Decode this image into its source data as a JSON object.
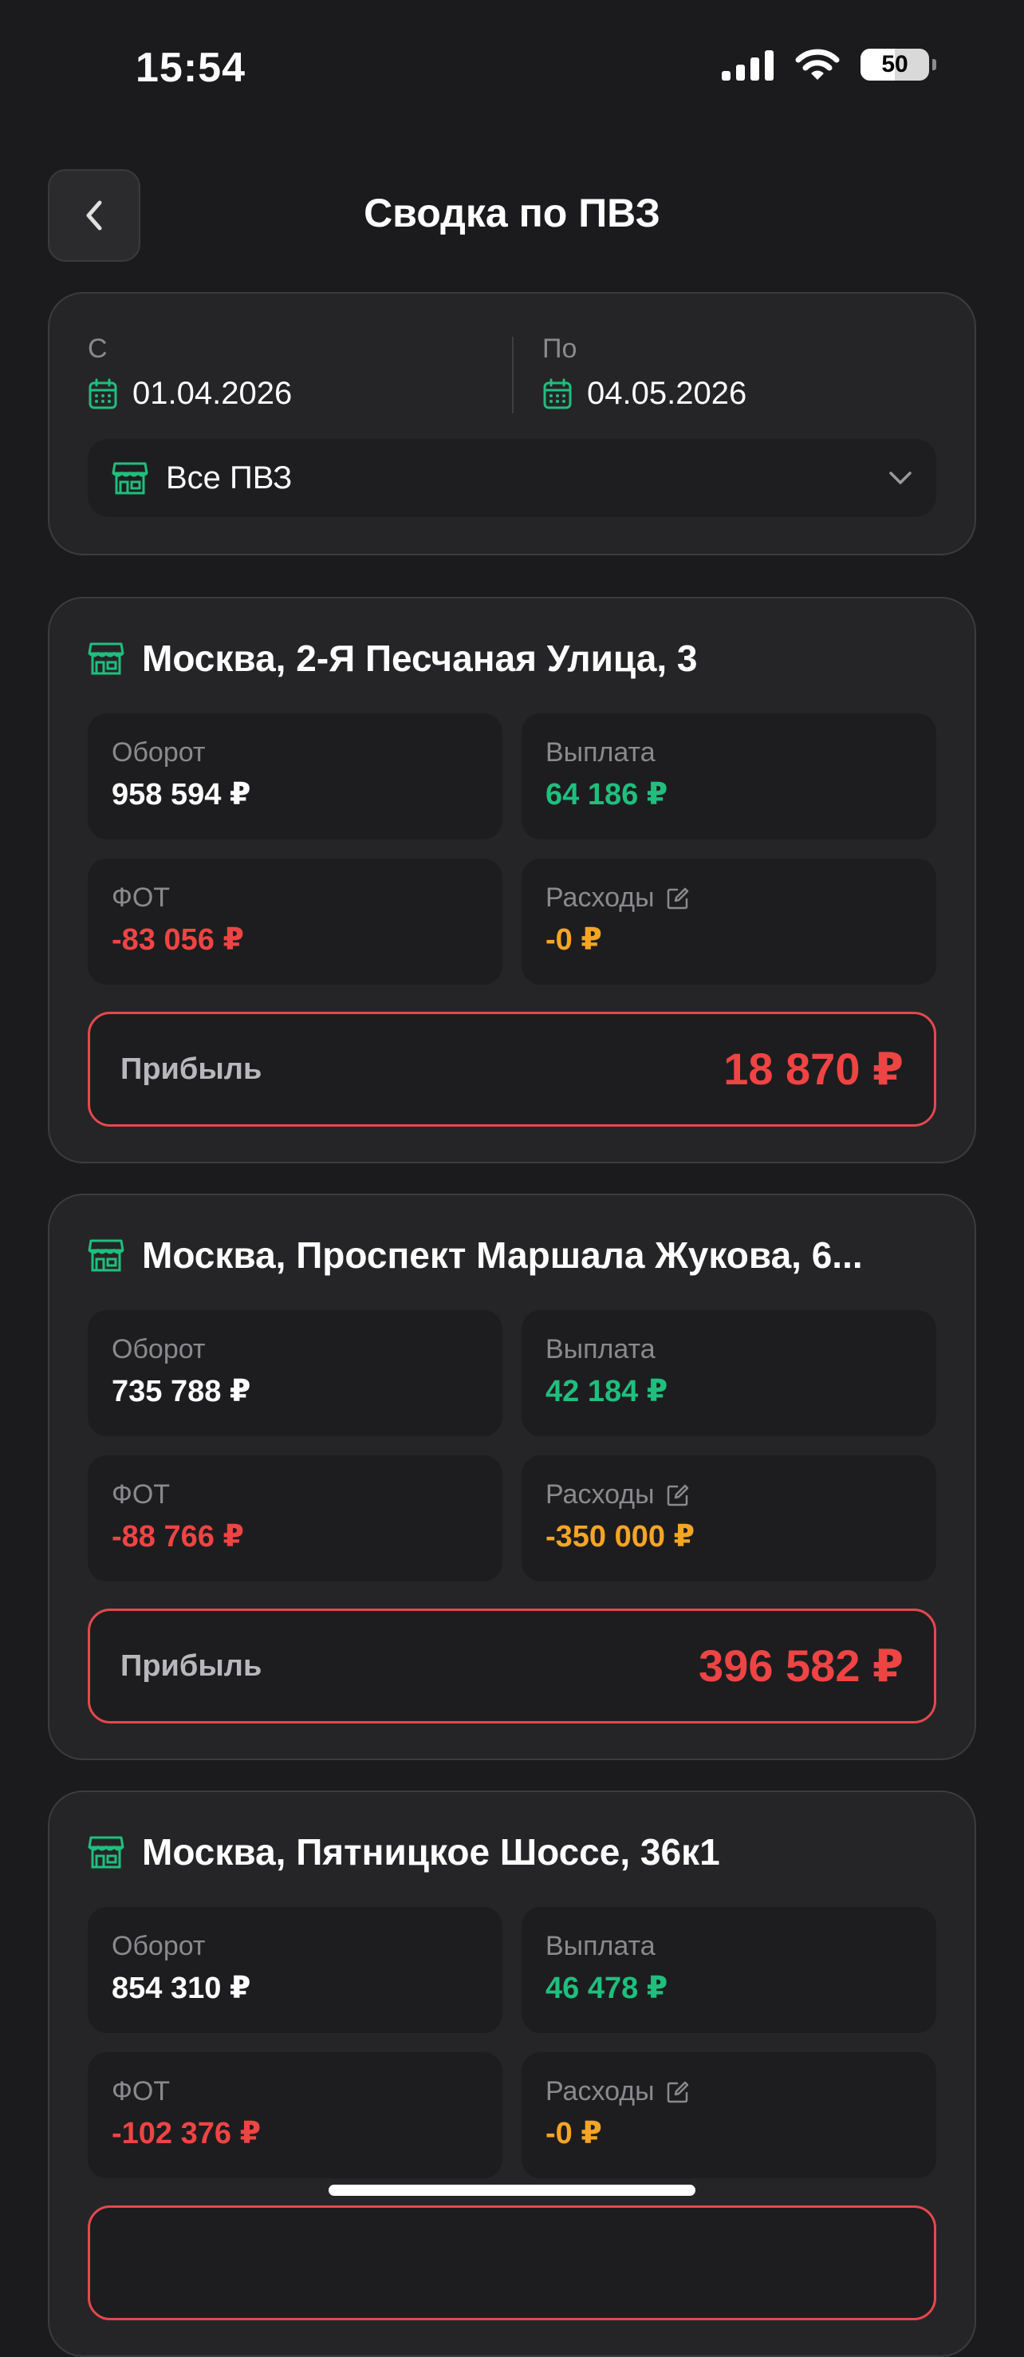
{
  "status_bar": {
    "time": "15:54",
    "battery": "50"
  },
  "header": {
    "title": "Сводка по ПВЗ"
  },
  "filter": {
    "from_label": "С",
    "from_date": "01.04.2026",
    "to_label": "По",
    "to_date": "04.05.2026",
    "pvz_select": "Все ПВЗ"
  },
  "colors": {
    "green": "#1fbf7e",
    "red": "#ef4444",
    "orange": "#f5a524",
    "background": "#1b1b1d"
  },
  "locations": [
    {
      "title": "Москва, 2-Я Песчаная Улица, 3",
      "turnover_label": "Оборот",
      "turnover": "958 594 ₽",
      "payout_label": "Выплата",
      "payout": "64 186 ₽",
      "payroll_label": "ФОТ",
      "payroll": "-83 056 ₽",
      "expenses_label": "Расходы",
      "expenses": "-0 ₽",
      "profit_label": "Прибыль",
      "profit": "18 870 ₽"
    },
    {
      "title": "Москва, Проспект Маршала Жукова, 6...",
      "turnover_label": "Оборот",
      "turnover": "735 788 ₽",
      "payout_label": "Выплата",
      "payout": "42 184 ₽",
      "payroll_label": "ФОТ",
      "payroll": "-88 766 ₽",
      "expenses_label": "Расходы",
      "expenses": "-350 000 ₽",
      "profit_label": "Прибыль",
      "profit": "396 582 ₽"
    },
    {
      "title": "Москва, Пятницкое Шоссе, 36к1",
      "turnover_label": "Оборот",
      "turnover": "854 310 ₽",
      "payout_label": "Выплата",
      "payout": "46 478 ₽",
      "payroll_label": "ФОТ",
      "payroll": "-102 376 ₽",
      "expenses_label": "Расходы",
      "expenses": "-0 ₽"
    }
  ]
}
